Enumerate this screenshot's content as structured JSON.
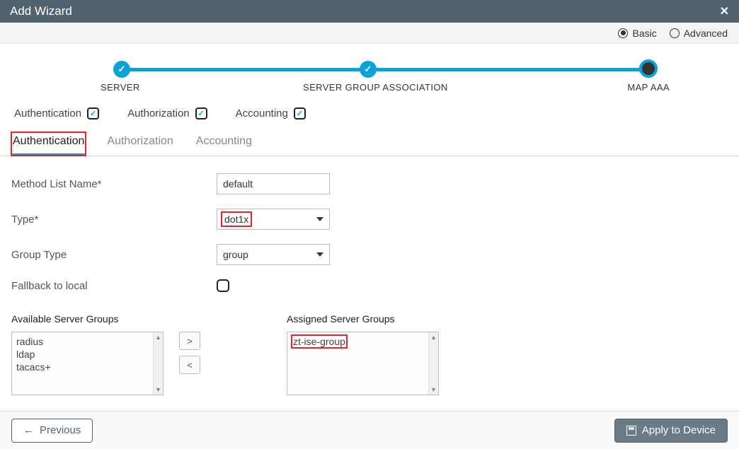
{
  "header": {
    "title": "Add Wizard"
  },
  "mode": {
    "basic_label": "Basic",
    "advanced_label": "Advanced",
    "selected": "basic"
  },
  "stepper": {
    "steps": [
      {
        "label": "SERVER",
        "state": "done"
      },
      {
        "label": "SERVER GROUP ASSOCIATION",
        "state": "done"
      },
      {
        "label": "MAP AAA",
        "state": "current"
      }
    ]
  },
  "aaa_checks": {
    "authentication": {
      "label": "Authentication",
      "checked": true
    },
    "authorization": {
      "label": "Authorization",
      "checked": true
    },
    "accounting": {
      "label": "Accounting",
      "checked": true
    }
  },
  "tabs": {
    "items": [
      {
        "label": "Authentication",
        "active": true
      },
      {
        "label": "Authorization",
        "active": false
      },
      {
        "label": "Accounting",
        "active": false
      }
    ]
  },
  "form": {
    "method_list_name": {
      "label": "Method List Name*",
      "value": "default"
    },
    "type": {
      "label": "Type*",
      "value": "dot1x"
    },
    "group_type": {
      "label": "Group Type",
      "value": "group"
    },
    "fallback": {
      "label": "Fallback to local",
      "checked": false
    }
  },
  "groups": {
    "available_label": "Available Server Groups",
    "assigned_label": "Assigned Server Groups",
    "available": [
      "radius",
      "ldap",
      "tacacs+"
    ],
    "assigned": [
      "zt-ise-group"
    ],
    "add_label": ">",
    "remove_label": "<"
  },
  "footer": {
    "previous_label": "Previous",
    "apply_label": "Apply to Device"
  }
}
